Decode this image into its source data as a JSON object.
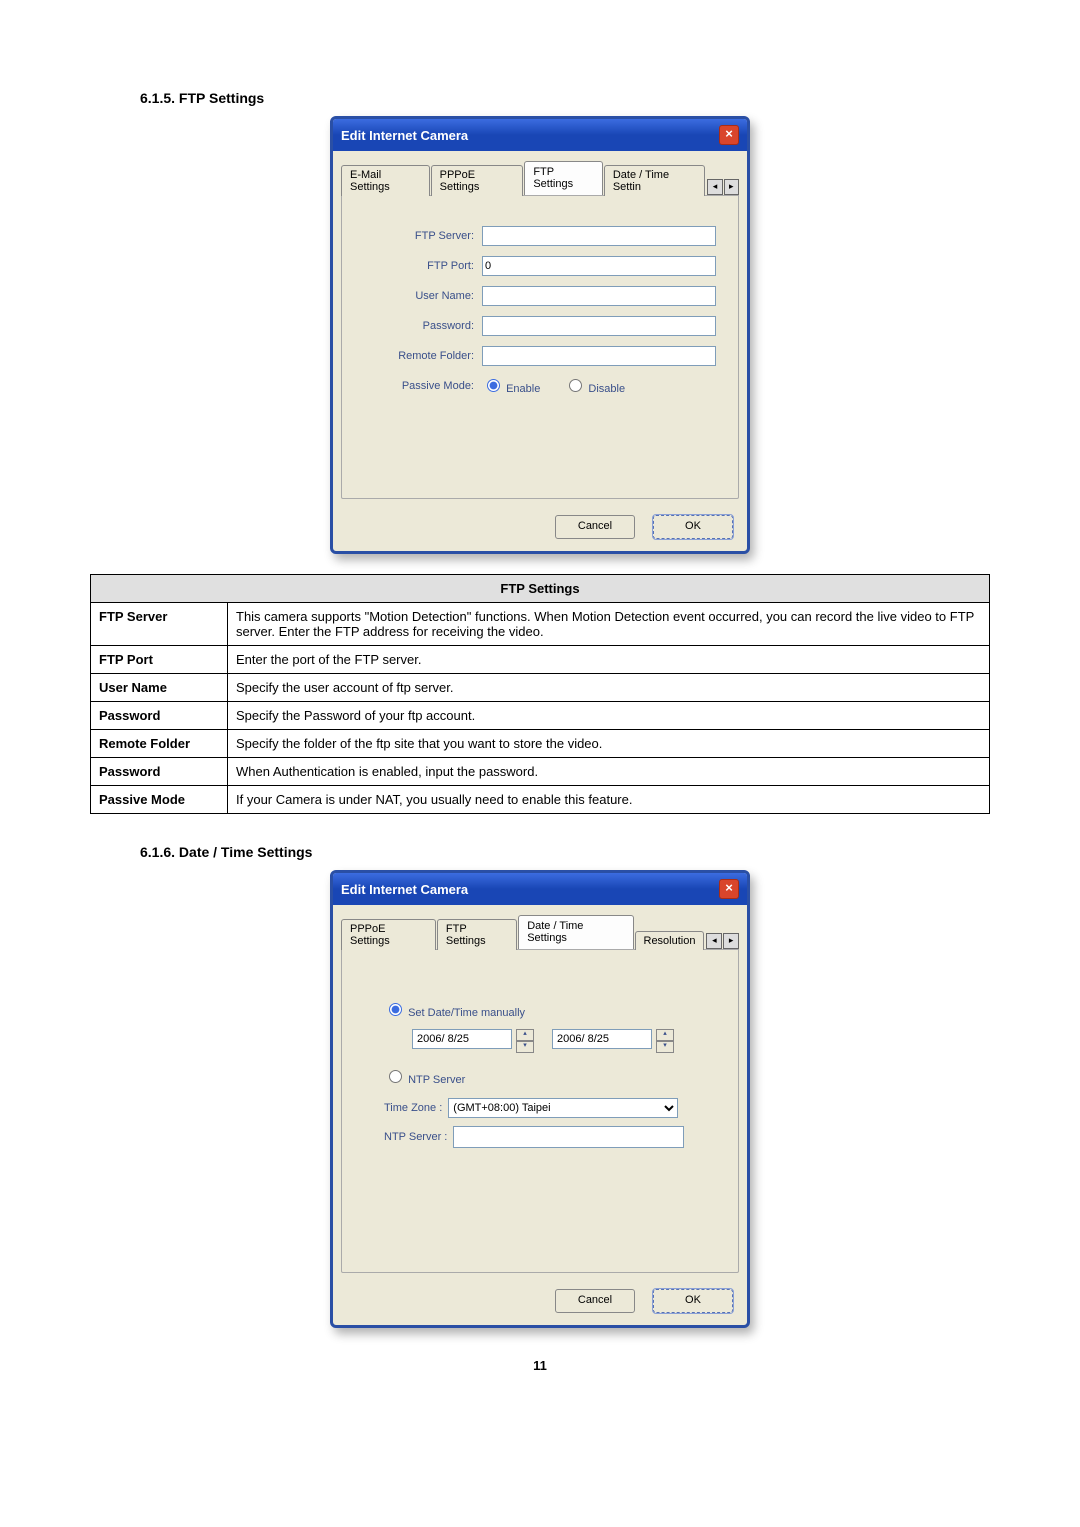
{
  "sections": {
    "ftp_heading": "6.1.5.   FTP Settings",
    "datetime_heading": "6.1.6.   Date / Time Settings"
  },
  "dialog_ftp": {
    "title": "Edit Internet Camera",
    "tabs": [
      "E-Mail Settings",
      "PPPoE Settings",
      "FTP Settings",
      "Date / Time Settin"
    ],
    "active_tab": 2,
    "fields": {
      "ftp_server_label": "FTP Server:",
      "ftp_server_value": "",
      "ftp_port_label": "FTP Port:",
      "ftp_port_value": "0",
      "user_name_label": "User Name:",
      "user_name_value": "",
      "password_label": "Password:",
      "password_value": "",
      "remote_folder_label": "Remote Folder:",
      "remote_folder_value": "",
      "passive_mode_label": "Passive Mode:",
      "enable_label": "Enable",
      "disable_label": "Disable"
    },
    "buttons": {
      "cancel": "Cancel",
      "ok": "OK"
    }
  },
  "dialog_datetime": {
    "title": "Edit Internet Camera",
    "tabs": [
      "PPPoE Settings",
      "FTP Settings",
      "Date / Time Settings",
      "Resolution"
    ],
    "active_tab": 2,
    "fields": {
      "set_manual_label": "Set Date/Time manually",
      "date1_value": "2006/ 8/25",
      "date2_value": "2006/ 8/25",
      "ntp_server_radio_label": "NTP Server",
      "timezone_label": "Time Zone :",
      "timezone_value": "(GMT+08:00) Taipei",
      "ntp_server_label": "NTP Server :",
      "ntp_server_value": ""
    },
    "buttons": {
      "cancel": "Cancel",
      "ok": "OK"
    }
  },
  "table": {
    "title": "FTP Settings",
    "rows": [
      {
        "head": "FTP Server",
        "body": "This camera supports \"Motion Detection\" functions. When Motion Detection event occurred, you can record the live video to FTP server. Enter the FTP address for receiving the video."
      },
      {
        "head": "FTP Port",
        "body": "Enter the port of the FTP server."
      },
      {
        "head": "User Name",
        "body": "Specify the user account of ftp server."
      },
      {
        "head": "Password",
        "body": "Specify the Password of your ftp account."
      },
      {
        "head": "Remote Folder",
        "body": "Specify the folder of the ftp site that you want to store the video."
      },
      {
        "head": "Password",
        "body": "When Authentication is enabled, input the password."
      },
      {
        "head": "Passive Mode",
        "body": "If your Camera is under NAT, you usually need to enable this feature."
      }
    ]
  },
  "page_number": "11"
}
